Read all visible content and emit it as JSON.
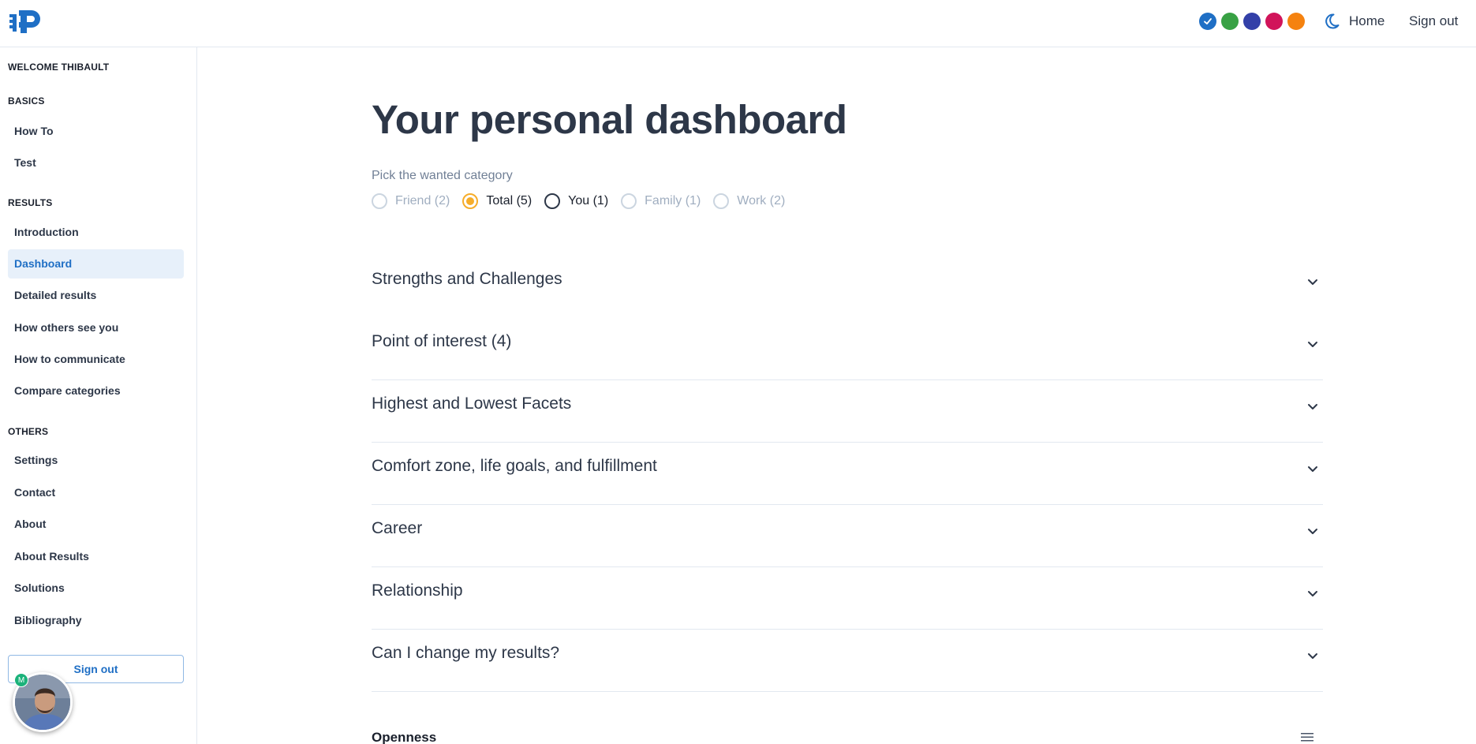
{
  "header": {
    "nav_home": "Home",
    "nav_signout": "Sign out",
    "theme_colors": [
      "#1f6fc5",
      "#38a144",
      "#3340a8",
      "#d1145a",
      "#f5820f"
    ],
    "selected_theme_index": 0
  },
  "sidebar": {
    "welcome": "WELCOME THIBAULT",
    "sections": [
      {
        "title": "BASICS",
        "items": [
          "How To",
          "Test"
        ]
      },
      {
        "title": "RESULTS",
        "items": [
          "Introduction",
          "Dashboard",
          "Detailed results",
          "How others see you",
          "How to communicate",
          "Compare categories"
        ]
      },
      {
        "title": "OTHERS",
        "items": [
          "Settings",
          "Contact",
          "About",
          "About Results",
          "Solutions",
          "Bibliography"
        ]
      }
    ],
    "active_item": "Dashboard",
    "signout_label": "Sign out",
    "avatar_badge": "M"
  },
  "main": {
    "title": "Your personal dashboard",
    "category_label": "Pick the wanted category",
    "categories": [
      {
        "label": "Friend (2)",
        "state": "disabled"
      },
      {
        "label": "Total (5)",
        "state": "checked"
      },
      {
        "label": "You (1)",
        "state": "normal"
      },
      {
        "label": "Family (1)",
        "state": "disabled"
      },
      {
        "label": "Work (2)",
        "state": "disabled"
      }
    ],
    "accordion": [
      "Strengths and Challenges",
      "Point of interest (4)",
      "Highest and Lowest Facets",
      "Comfort zone, life goals, and fulfillment",
      "Career",
      "Relationship",
      "Can I change my results?"
    ],
    "section_title": "Openness"
  }
}
